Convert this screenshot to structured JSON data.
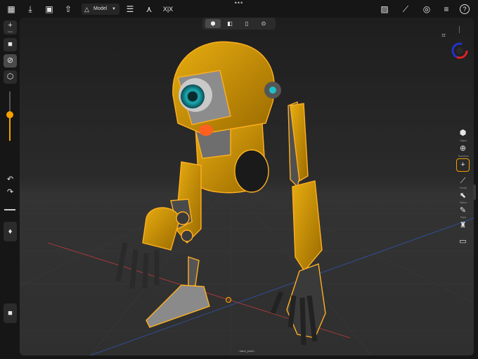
{
  "toolbar": {
    "mode_label": "Model",
    "caret": "▼",
    "icons": [
      "apps-icon",
      "import-icon",
      "save-icon",
      "share-icon",
      "model-mode-icon",
      "outliner-icon",
      "graph-icon",
      "symmetry-icon",
      "image-icon",
      "edit-image-icon",
      "material-icon",
      "settings-icon",
      "help-icon"
    ],
    "symmetry_label": "X|X",
    "help_label": "?"
  },
  "left_toolbar": {
    "add_caption": "Insert",
    "slider_level": 0.53
  },
  "view_cube_tabs": [
    "perspective",
    "front",
    "side",
    "top"
  ],
  "right_toolbar": {
    "items": [
      "Object",
      "Transform",
      "Add",
      "Sculpt",
      "Select",
      "Paint",
      "Pose",
      "Extra"
    ]
  },
  "status": {
    "selected_object": "- hand_joint1 -"
  },
  "colors": {
    "accent": "#f0a000",
    "robot_body": "#d89a00",
    "robot_outline": "#ffb020",
    "eye": "#1fc0c8",
    "x_axis": "#e04040",
    "z_axis": "#3060d0",
    "background": "#161616"
  }
}
